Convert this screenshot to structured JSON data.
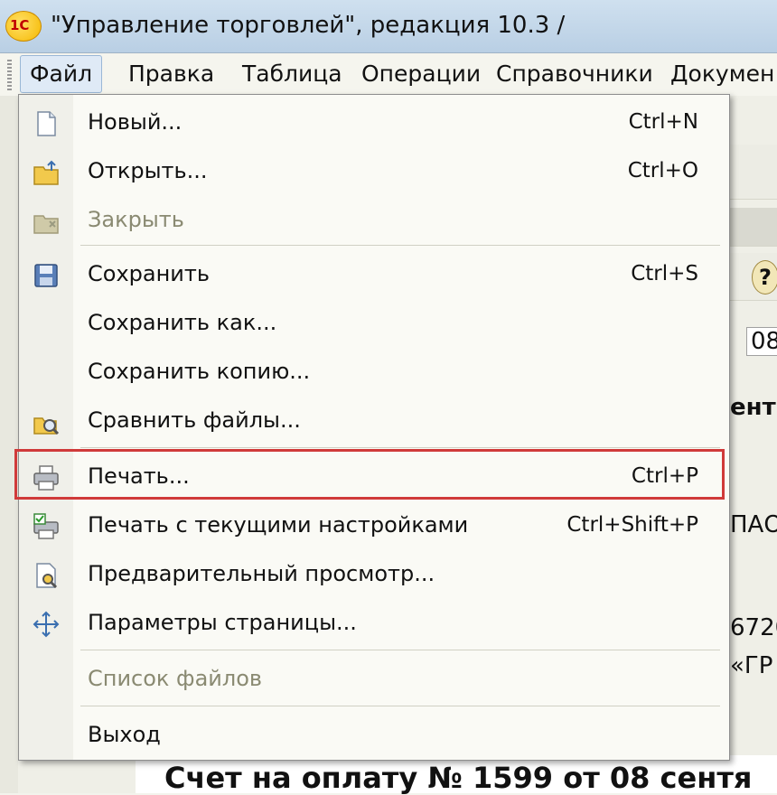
{
  "window": {
    "title": "\"Управление торговлей\", редакция 10.3 /",
    "logo_text": "1С"
  },
  "menubar": {
    "items": [
      {
        "label": "Файл",
        "active": true
      },
      {
        "label": "Правка"
      },
      {
        "label": "Таблица"
      },
      {
        "label": "Операции"
      },
      {
        "label": "Справочники"
      },
      {
        "label": "Докумен"
      }
    ]
  },
  "file_menu": {
    "items": [
      {
        "label": "Новый...",
        "shortcut": "Ctrl+N",
        "icon": "new-document-icon"
      },
      {
        "label": "Открыть...",
        "shortcut": "Ctrl+O",
        "icon": "open-folder-icon"
      },
      {
        "label": "Закрыть",
        "shortcut": "",
        "icon": "close-folder-icon",
        "disabled": true
      },
      {
        "label": "Сохранить",
        "shortcut": "Ctrl+S",
        "icon": "save-icon"
      },
      {
        "label": "Сохранить как...",
        "shortcut": ""
      },
      {
        "label": "Сохранить копию...",
        "shortcut": ""
      },
      {
        "label": "Сравнить файлы...",
        "shortcut": "",
        "icon": "compare-files-icon"
      },
      {
        "label": "Печать...",
        "shortcut": "Ctrl+P",
        "icon": "printer-icon",
        "highlighted": true
      },
      {
        "label": "Печать с текущими настройками",
        "shortcut": "Ctrl+Shift+P",
        "icon": "quick-print-icon"
      },
      {
        "label": "Предварительный просмотр...",
        "shortcut": "",
        "icon": "print-preview-icon"
      },
      {
        "label": "Параметры страницы...",
        "shortcut": "",
        "icon": "page-setup-icon"
      },
      {
        "label": "Список файлов",
        "shortcut": "",
        "disabled": true
      },
      {
        "label": "Выход",
        "shortcut": ""
      }
    ]
  },
  "background": {
    "fragments": [
      "ент",
      "ПАО",
      "6720",
      "«ГР",
      "08",
      "?"
    ],
    "document_title": "Счет на оплату № 1599 от 08 сентя"
  },
  "colors": {
    "highlight_border": "#d03a3a",
    "menu_bg": "#fafaf5",
    "disabled_text": "#8a8a72"
  }
}
